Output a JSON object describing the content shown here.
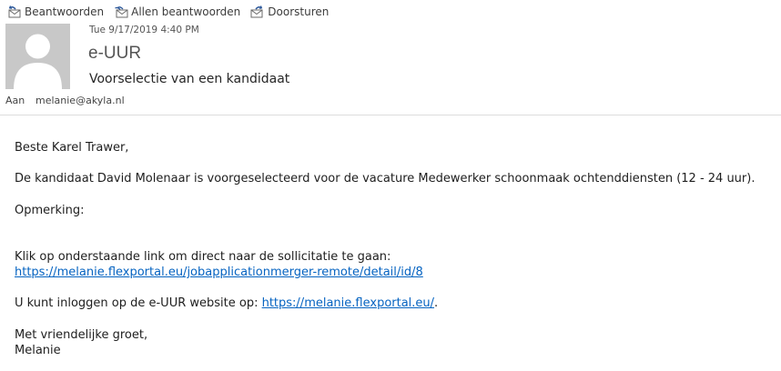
{
  "toolbar": {
    "reply": "Beantwoorden",
    "reply_all": "Allen beantwoorden",
    "forward": "Doorsturen"
  },
  "header": {
    "datetime": "Tue 9/17/2019 4:40 PM",
    "sender": "e-UUR",
    "subject": "Voorselectie van een kandidaat",
    "to_label": "Aan",
    "to_value": "melanie@akyla.nl"
  },
  "message": {
    "greeting": "Beste Karel Trawer,",
    "para1": "De kandidaat David Molenaar is voorgeselecteerd voor de vacature Medewerker schoonmaak ochtenddiensten (12 - 24 uur).",
    "remark_label": "Opmerking:",
    "link_intro": "Klik op onderstaande link om direct naar de sollicitatie te gaan:",
    "link1": "https://melanie.flexportal.eu/jobapplicationmerger-remote/detail/id/8",
    "login_text": "U kunt inloggen op de e-UUR website op: ",
    "link2": "https://melanie.flexportal.eu/",
    "period": ".",
    "closing": "Met vriendelijke groet,",
    "signature": "Melanie"
  },
  "colors": {
    "link": "#0563c1",
    "icon": "#2b579a",
    "avatar_bg": "#c8c8c8"
  }
}
